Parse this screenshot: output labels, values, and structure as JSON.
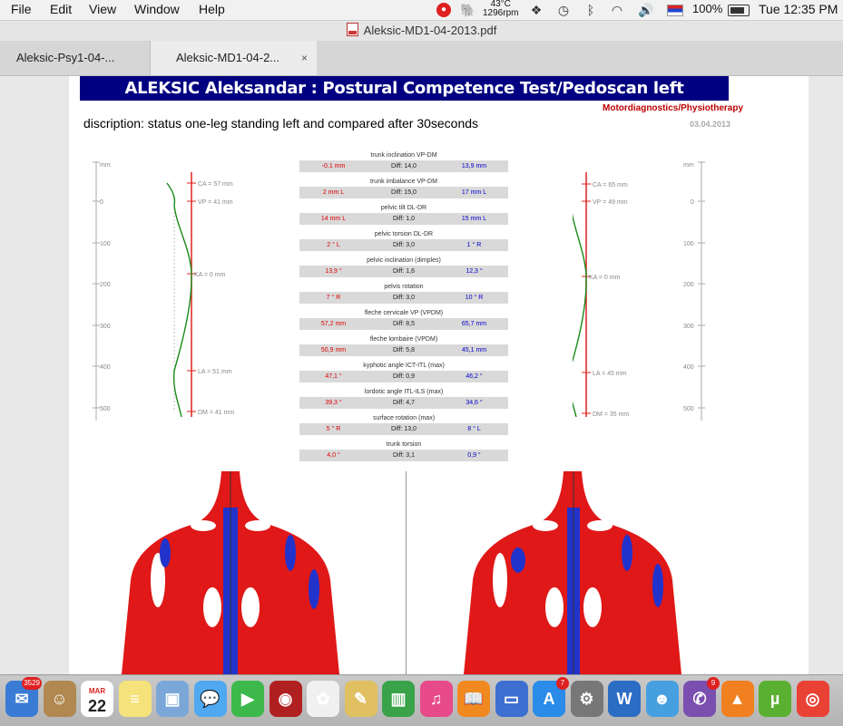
{
  "menubar": {
    "items": [
      "File",
      "Edit",
      "View",
      "Window",
      "Help"
    ],
    "temperature": "43°C",
    "rpm": "1296rpm",
    "battery": "100%",
    "clock": "Tue 12:35 PM"
  },
  "window": {
    "title": "Aleksic-MD1-04-2013.pdf"
  },
  "tabs": [
    {
      "label": "Aleksic-Psy1-04-..."
    },
    {
      "label": "Aleksic-MD1-04-2...",
      "close": "×"
    }
  ],
  "document": {
    "header": "ALEKSIC Aleksandar : Postural Competence Test/Pedoscan left",
    "subtitle": "Motordiagnostics/Physiotherapy",
    "date": "03.04.2013",
    "description": "discription: status one-leg standing left and compared after 30seconds",
    "left_profile": {
      "unit": "mm",
      "ticks": [
        "0",
        "100",
        "200",
        "300",
        "400",
        "500"
      ],
      "labels": {
        "CA": "CA = 57 mm",
        "VP": "VP = 41 mm",
        "KA": "KA = 0 mm",
        "LA": "LA = 51 mm",
        "DM": "DM = 41 mm"
      }
    },
    "right_profile": {
      "unit": "mm",
      "ticks": [
        "0",
        "100",
        "200",
        "300",
        "400",
        "500"
      ],
      "labels": {
        "CA": "CA = 65 mm",
        "VP": "VP = 49 mm",
        "KA": "KA = 0 mm",
        "LA": "LA = 45 mm",
        "DM": "DM = 35 mm"
      }
    },
    "metrics": [
      {
        "title": "trunk inclination VP-DM",
        "left": "-0,1 mm",
        "diff": "Diff: 14,0",
        "right": "13,9 mm"
      },
      {
        "title": "trunk imbalance VP-DM",
        "left": "2 mm   L",
        "diff": "Diff: 15,0",
        "right": "17 mm   L"
      },
      {
        "title": "pelvic tilt DL-DR",
        "left": "14 mm   L",
        "diff": "Diff: 1,0",
        "right": "15 mm   L"
      },
      {
        "title": "pelvic torsion DL-DR",
        "left": "2 °     L",
        "diff": "Diff: 3,0",
        "right": "1 °      R"
      },
      {
        "title": "pelvic inclination (dimples)",
        "left": "13,9 °",
        "diff": "Diff: 1,6",
        "right": "12,3 °"
      },
      {
        "title": "pelvis rotation",
        "left": "7 °      R",
        "diff": "Diff: 3,0",
        "right": "10 °     R"
      },
      {
        "title": "fleche cervicale VP (VPDM)",
        "left": "57,2 mm",
        "diff": "Diff: 8,5",
        "right": "65,7 mm"
      },
      {
        "title": "fleche lombaire (VPDM)",
        "left": "50,9 mm",
        "diff": "Diff: 5,8",
        "right": "45,1 mm"
      },
      {
        "title": "kyphotic angle ICT-ITL (max)",
        "left": "47,1 °",
        "diff": "Diff: 0,9",
        "right": "46,2 °"
      },
      {
        "title": "lordotic angle ITL-ILS (max)",
        "left": "39,3 °",
        "diff": "Diff: 4,7",
        "right": "34,6 °"
      },
      {
        "title": "surface rotation (max)",
        "left": "5 °     R",
        "diff": "Diff: 13,0",
        "right": "8 °      L"
      },
      {
        "title": "trunk torsion",
        "left": "4,0 °",
        "diff": "Diff: 3,1",
        "right": "0,9 °"
      }
    ]
  },
  "dock": {
    "items": [
      {
        "name": "mail",
        "badge": "3529",
        "color": "#3a7bd5",
        "glyph": "✉"
      },
      {
        "name": "contacts",
        "color": "#b08850",
        "glyph": "☺"
      },
      {
        "name": "calendar",
        "month": "MAR",
        "day": "22",
        "color": "#ffffff",
        "glyph": ""
      },
      {
        "name": "notes",
        "color": "#f6e27a",
        "glyph": "≡"
      },
      {
        "name": "preview",
        "color": "#7aa7d8",
        "glyph": "▣"
      },
      {
        "name": "messages",
        "color": "#4fa8f0",
        "glyph": "💬"
      },
      {
        "name": "facetime",
        "color": "#3cb94a",
        "glyph": "▶"
      },
      {
        "name": "photo-booth",
        "color": "#b02020",
        "glyph": "◉"
      },
      {
        "name": "photos",
        "color": "#f0f0f0",
        "glyph": "✿"
      },
      {
        "name": "textedit",
        "color": "#e0c060",
        "glyph": "✎"
      },
      {
        "name": "numbers",
        "color": "#3aa34a",
        "glyph": "▥"
      },
      {
        "name": "itunes",
        "color": "#e64a8a",
        "glyph": "♫"
      },
      {
        "name": "ibooks",
        "color": "#f08a20",
        "glyph": "📖"
      },
      {
        "name": "keynote",
        "color": "#3d6fd0",
        "glyph": "▭"
      },
      {
        "name": "app-store",
        "badge": "7",
        "color": "#2a8be8",
        "glyph": "A"
      },
      {
        "name": "system-preferences",
        "color": "#777777",
        "glyph": "⚙"
      },
      {
        "name": "word",
        "color": "#2b6cc4",
        "glyph": "W"
      },
      {
        "name": "messenger",
        "color": "#46a0e0",
        "glyph": "☻"
      },
      {
        "name": "viber",
        "badge": "9",
        "color": "#7b4fb0",
        "glyph": "✆"
      },
      {
        "name": "vlc",
        "color": "#f08020",
        "glyph": "▲"
      },
      {
        "name": "utorrent",
        "color": "#5ab030",
        "glyph": "µ"
      },
      {
        "name": "chrome",
        "color": "#e94235",
        "glyph": "◎"
      }
    ]
  }
}
